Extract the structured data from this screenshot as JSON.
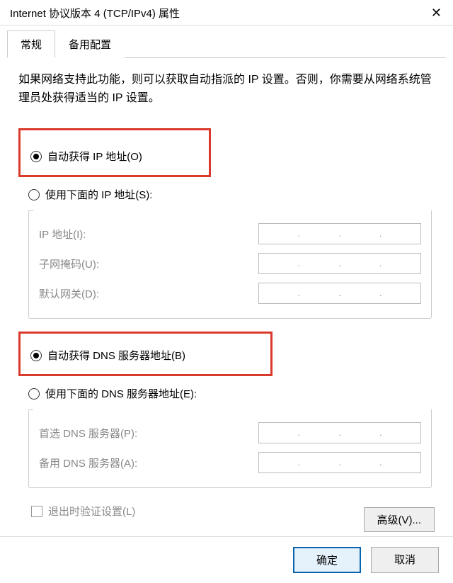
{
  "titlebar": {
    "title": "Internet 协议版本 4 (TCP/IPv4) 属性"
  },
  "tabs": {
    "general": "常规",
    "alternate": "备用配置"
  },
  "desc": "如果网络支持此功能，则可以获取自动指派的 IP 设置。否则，你需要从网络系统管理员处获得适当的 IP 设置。",
  "ip": {
    "auto": "自动获得 IP 地址(O)",
    "manual": "使用下面的 IP 地址(S):",
    "addr": "IP 地址(I):",
    "mask": "子网掩码(U):",
    "gw": "默认网关(D):"
  },
  "dns": {
    "auto": "自动获得 DNS 服务器地址(B)",
    "manual": "使用下面的 DNS 服务器地址(E):",
    "preferred": "首选 DNS 服务器(P):",
    "alt": "备用 DNS 服务器(A):"
  },
  "validate": "退出时验证设置(L)",
  "advanced": "高级(V)...",
  "ok": "确定",
  "cancel": "取消"
}
